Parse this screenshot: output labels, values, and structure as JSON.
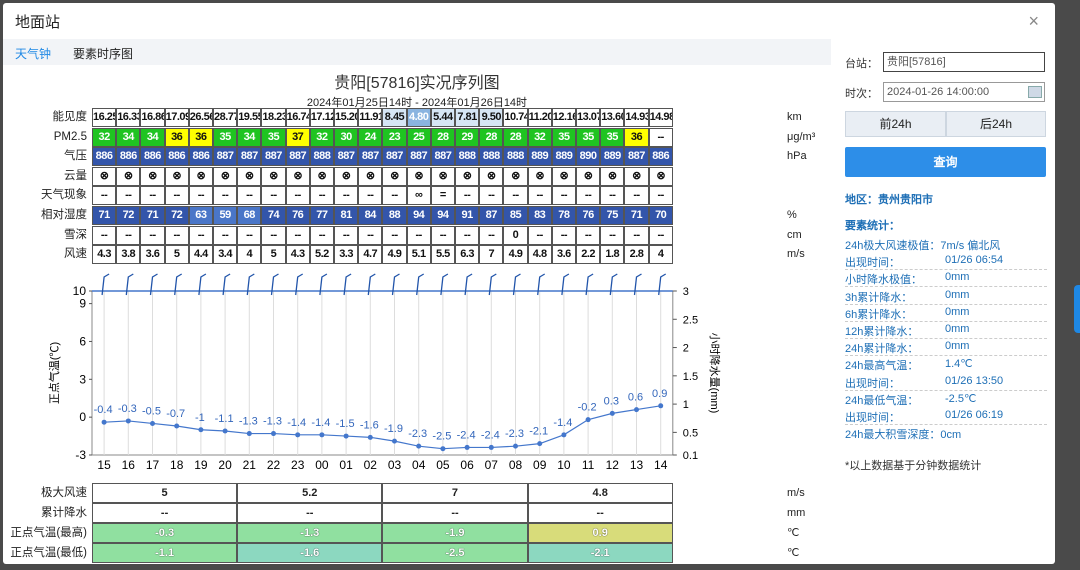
{
  "dialog": {
    "title": "地面站",
    "close": "×"
  },
  "tabs": [
    {
      "label": "天气钟",
      "active": true
    },
    {
      "label": "要素时序图",
      "active": false
    }
  ],
  "chart_title": "贵阳[57816]实况序列图",
  "chart_subtitle": "2024年01月25日14时 - 2024年01月26日14时",
  "rows": [
    {
      "label": "能见度",
      "unit": "km",
      "values": [
        "16.25",
        "16.33",
        "16.86",
        "17.09",
        "26.56",
        "28.77",
        "19.55",
        "18.23",
        "16.74",
        "17.12",
        "15.20",
        "11.91",
        "8.45",
        "4.80",
        "5.44",
        "7.81",
        "9.50",
        "10.74",
        "11.20",
        "12.16",
        "13.07",
        "13.60",
        "14.93",
        "14.98"
      ]
    },
    {
      "label": "PM2.5",
      "unit": "μg/m³",
      "values": [
        "32",
        "34",
        "34",
        "36",
        "36",
        "35",
        "34",
        "35",
        "37",
        "32",
        "30",
        "24",
        "23",
        "25",
        "28",
        "29",
        "28",
        "28",
        "32",
        "35",
        "35",
        "35",
        "36",
        "--"
      ]
    },
    {
      "label": "气压",
      "unit": "hPa",
      "values": [
        "886",
        "886",
        "886",
        "886",
        "886",
        "887",
        "887",
        "887",
        "887",
        "888",
        "887",
        "887",
        "887",
        "887",
        "887",
        "888",
        "888",
        "888",
        "889",
        "889",
        "890",
        "889",
        "887",
        "886"
      ]
    },
    {
      "label": "云量",
      "unit": "",
      "values": [
        "⊗",
        "⊗",
        "⊗",
        "⊗",
        "⊗",
        "⊗",
        "⊗",
        "⊗",
        "⊗",
        "⊗",
        "⊗",
        "⊗",
        "⊗",
        "⊗",
        "⊗",
        "⊗",
        "⊗",
        "⊗",
        "⊗",
        "⊗",
        "⊗",
        "⊗",
        "⊗",
        "⊗"
      ]
    },
    {
      "label": "天气现象",
      "unit": "",
      "values": [
        "--",
        "--",
        "--",
        "--",
        "--",
        "--",
        "--",
        "--",
        "--",
        "--",
        "--",
        "--",
        "--",
        "∞",
        "=",
        "--",
        "--",
        "--",
        "--",
        "--",
        "--",
        "--",
        "--",
        "--"
      ]
    },
    {
      "label": "相对湿度",
      "unit": "%",
      "values": [
        "71",
        "72",
        "71",
        "72",
        "63",
        "59",
        "68",
        "74",
        "76",
        "77",
        "81",
        "84",
        "88",
        "94",
        "94",
        "91",
        "87",
        "85",
        "83",
        "78",
        "76",
        "75",
        "71",
        "70"
      ]
    },
    {
      "label": "雪深",
      "unit": "cm",
      "values": [
        "--",
        "--",
        "--",
        "--",
        "--",
        "--",
        "--",
        "--",
        "--",
        "--",
        "--",
        "--",
        "--",
        "--",
        "--",
        "--",
        "--",
        "0",
        "--",
        "--",
        "--",
        "--",
        "--",
        "--"
      ]
    },
    {
      "label": "风速",
      "unit": "m/s",
      "values": [
        "4.3",
        "3.8",
        "3.6",
        "5",
        "4.4",
        "3.4",
        "4",
        "5",
        "4.3",
        "5.2",
        "3.3",
        "4.7",
        "4.9",
        "5.1",
        "5.5",
        "6.3",
        "7",
        "4.9",
        "4.8",
        "3.6",
        "2.2",
        "1.8",
        "2.8",
        "4"
      ]
    }
  ],
  "colors": {
    "vis_clear": "#ffffff",
    "vis_mid": "#d6e6f5",
    "vis_low": "#8ab4e0",
    "pm_good": "#1fc421",
    "pm_mod": "#ffff00",
    "press": "#3355aa",
    "rh_low": "#4a76c8",
    "rh_high": "#3355aa",
    "temp_green": "#90e0a0",
    "temp_yellow": "#d8dc7a",
    "temp_teal": "#8cd8c0",
    "line": "#4477cc"
  },
  "chart_data": {
    "type": "line",
    "x": [
      "15",
      "16",
      "17",
      "18",
      "19",
      "20",
      "21",
      "22",
      "23",
      "00",
      "01",
      "02",
      "03",
      "04",
      "05",
      "06",
      "07",
      "08",
      "09",
      "10",
      "11",
      "12",
      "13",
      "14"
    ],
    "series": [
      {
        "values": [
          -0.4,
          -0.3,
          -0.5,
          -0.7,
          -1,
          -1.1,
          -1.3,
          -1.3,
          -1.4,
          -1.4,
          -1.5,
          -1.6,
          -1.9,
          -2.3,
          -2.5,
          -2.4,
          -2.4,
          -2.3,
          -2.1,
          -1.4,
          -0.2,
          0.3,
          0.6,
          0.9
        ]
      }
    ],
    "ylabel": "正点气温(℃)",
    "y2label": "小时降水量(mm)",
    "ylim": [
      -3,
      10
    ],
    "yticks": [
      -3,
      0,
      3,
      6,
      9,
      10
    ],
    "y2lim": [
      0.1,
      3
    ],
    "y2ticks": [
      "0.1",
      "0.5",
      "1",
      "1.5",
      "2",
      "2.5",
      "3"
    ],
    "grid": true
  },
  "bottom_rows": [
    {
      "label": "极大风速",
      "unit": "m/s",
      "values": [
        "5",
        "5.2",
        "7",
        "4.8"
      ]
    },
    {
      "label": "累计降水",
      "unit": "mm",
      "values": [
        "--",
        "--",
        "--",
        "--"
      ]
    },
    {
      "label": "正点气温(最高)",
      "unit": "℃",
      "values": [
        "-0.3",
        "-1.3",
        "-1.9",
        "0.9"
      ]
    },
    {
      "label": "正点气温(最低)",
      "unit": "℃",
      "values": [
        "-1.1",
        "-1.6",
        "-2.5",
        "-2.1"
      ]
    }
  ],
  "side": {
    "station_label": "台站：",
    "station_value": "贵阳[57816]",
    "time_label": "时次：",
    "time_value": "2024-01-26 14:00:00",
    "prev": "前24h",
    "next": "后24h",
    "query": "查询",
    "region": "地区：贵州贵阳市",
    "stats_title": "要素统计：",
    "stats": [
      {
        "k": "24h极大风速极值：",
        "v": "7m/s 偏北风"
      },
      {
        "k": "出现时间：",
        "v": "01/26 06:54"
      },
      {
        "k": "小时降水极值：",
        "v": "0mm"
      },
      {
        "k": "3h累计降水：",
        "v": "0mm"
      },
      {
        "k": "6h累计降水：",
        "v": "0mm"
      },
      {
        "k": "12h累计降水：",
        "v": "0mm"
      },
      {
        "k": "24h累计降水：",
        "v": "0mm"
      },
      {
        "k": "24h最高气温：",
        "v": "1.4℃"
      },
      {
        "k": "出现时间：",
        "v": "01/26 13:50"
      },
      {
        "k": "24h最低气温：",
        "v": "-2.5℃"
      },
      {
        "k": "出现时间：",
        "v": "01/26 06:19"
      },
      {
        "k": "24h最大积雪深度：",
        "v": "0cm"
      }
    ],
    "note": "*以上数据基于分钟数据统计"
  }
}
